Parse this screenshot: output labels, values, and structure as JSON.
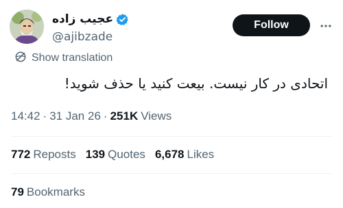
{
  "author": {
    "display_name": "عجیب زاده",
    "handle": "@ajibzade",
    "verified_icon": "verified-badge-icon",
    "verified_color": "#1d9bf0",
    "avatar_icon": "avatar-illustration"
  },
  "follow_button": {
    "label": "Follow",
    "background": "#0f1419",
    "text_color": "#ffffff"
  },
  "more_button": {
    "icon": "more-horizontal-icon"
  },
  "translation": {
    "label": "Show translation",
    "icon": "translate-globe-icon"
  },
  "tweet": {
    "text": "اتحادی در کار نیست. بیعت کنید یا حذف شوید!"
  },
  "meta": {
    "time": "14:42",
    "separator": "·",
    "date": "31 Jan 26",
    "views_count": "251K",
    "views_label": "Views"
  },
  "stats": [
    {
      "count": "772",
      "label": "Reposts"
    },
    {
      "count": "139",
      "label": "Quotes"
    },
    {
      "count": "6,678",
      "label": "Likes"
    }
  ],
  "bookmarks": {
    "count": "79",
    "label": "Bookmarks"
  },
  "colors": {
    "primary_text": "#0f1419",
    "secondary_text": "#536471",
    "divider": "#eff3f4"
  }
}
